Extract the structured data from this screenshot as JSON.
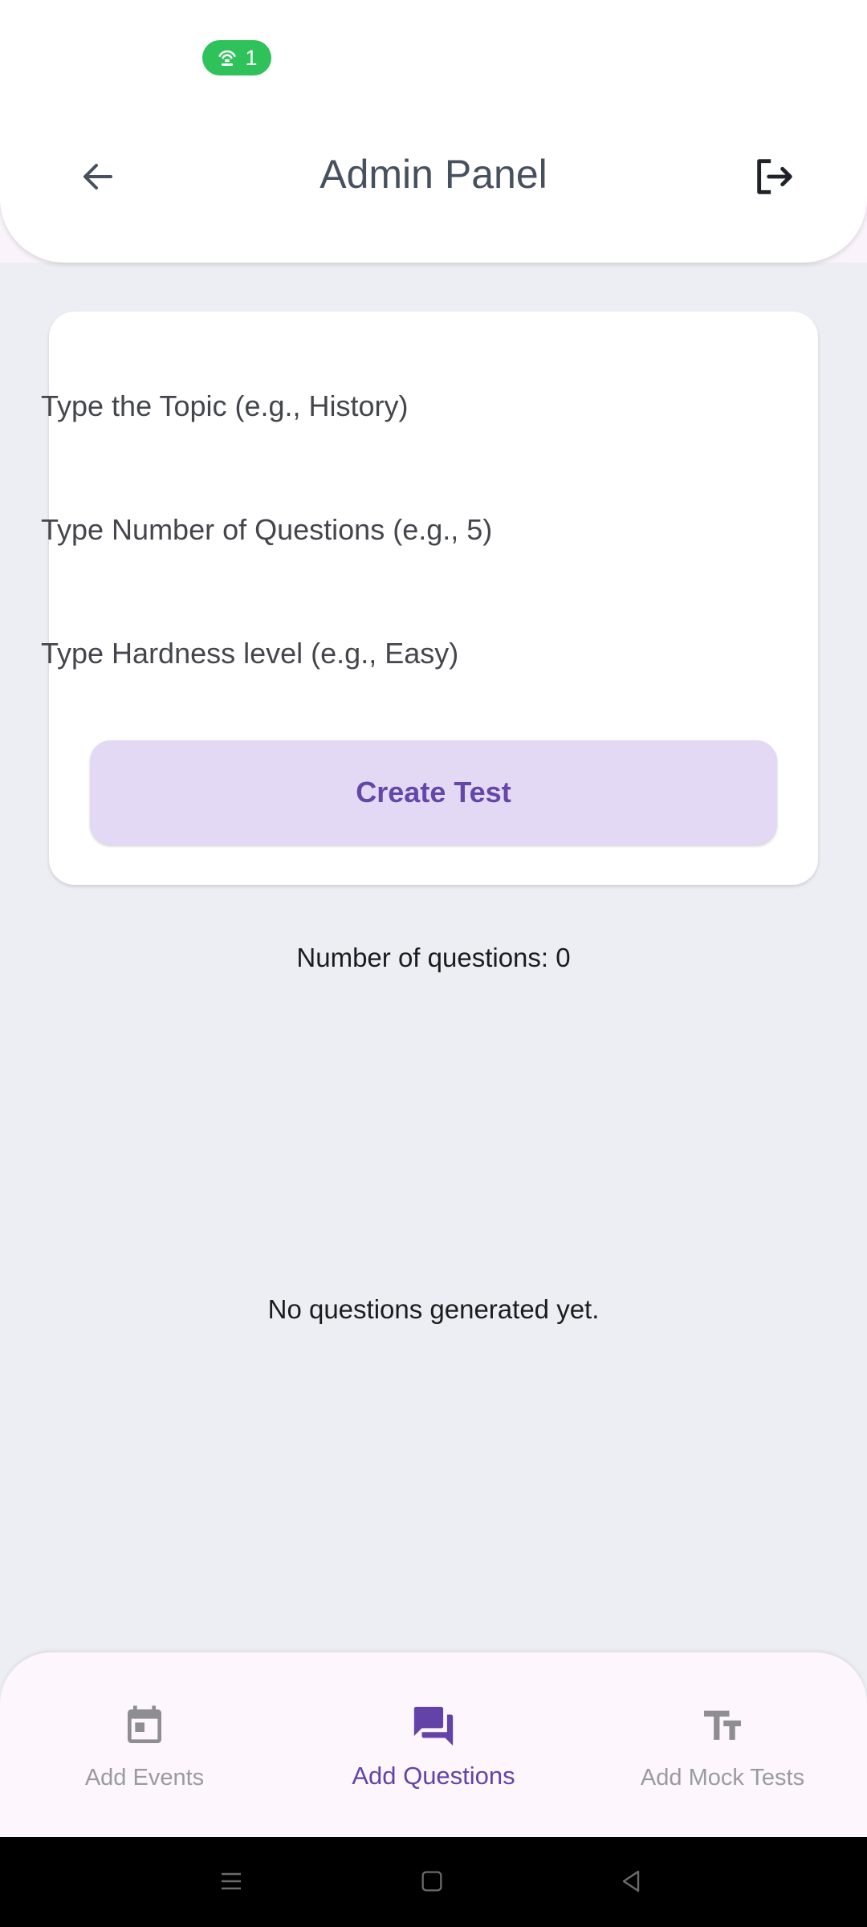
{
  "status_bar": {
    "hotspot_count": "1",
    "icon": "hotspot-icon"
  },
  "app_bar": {
    "title": "Admin Panel",
    "back_icon": "arrow-left-icon",
    "logout_icon": "logout-icon"
  },
  "form": {
    "topic_placeholder": "Type the Topic (e.g., History)",
    "topic_value": "",
    "count_placeholder": "Type Number of Questions (e.g., 5)",
    "count_value": "",
    "level_placeholder": "Type Hardness level (e.g., Easy)",
    "level_value": "",
    "create_label": "Create Test"
  },
  "results": {
    "question_count_text": "Number of questions: 0",
    "empty_text": "No questions generated yet."
  },
  "bottom_nav": {
    "items": [
      {
        "label": "Add Events",
        "icon": "calendar-icon",
        "active": false
      },
      {
        "label": "Add Questions",
        "icon": "forum-icon",
        "active": true
      },
      {
        "label": "Add Mock Tests",
        "icon": "text-fields-icon",
        "active": false
      }
    ]
  },
  "colors": {
    "accent": "#6343a8",
    "button_bg": "#e3d9f4",
    "background": "#edeef3",
    "status_green": "#2fc15a"
  }
}
